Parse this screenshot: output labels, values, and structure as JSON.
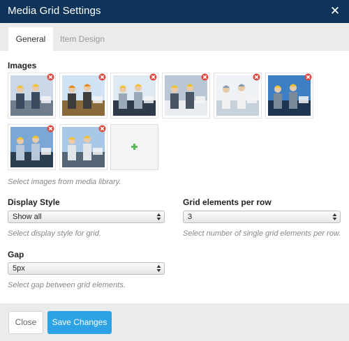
{
  "dialog": {
    "title": "Media Grid Settings",
    "close_icon": "close-icon"
  },
  "tabs": [
    {
      "label": "General",
      "active": true
    },
    {
      "label": "Item Design",
      "active": false
    }
  ],
  "images": {
    "label": "Images",
    "help": "Select images from media library.",
    "thumbnails": [
      {
        "subject": "workers-reviewing-plans",
        "remove_icon": "remove-icon"
      },
      {
        "subject": "construction-tractors",
        "remove_icon": "remove-icon"
      },
      {
        "subject": "engineers-team",
        "remove_icon": "remove-icon"
      },
      {
        "subject": "blueprint-meeting",
        "remove_icon": "remove-icon"
      },
      {
        "subject": "technical-drawing",
        "remove_icon": "remove-icon"
      },
      {
        "subject": "engineer-on-site",
        "remove_icon": "remove-icon"
      },
      {
        "subject": "steel-frame-workers",
        "remove_icon": "remove-icon"
      },
      {
        "subject": "site-inspection",
        "remove_icon": "remove-icon"
      }
    ],
    "add_icon": "add-icon"
  },
  "display_style": {
    "label": "Display Style",
    "value": "Show all",
    "help": "Select display style for grid."
  },
  "grid_per_row": {
    "label": "Grid elements per row",
    "value": "3",
    "help": "Select number of single grid elements per row."
  },
  "gap": {
    "label": "Gap",
    "value": "5px",
    "help": "Select gap between grid elements."
  },
  "footer": {
    "close_label": "Close",
    "save_label": "Save Changes"
  },
  "colors": {
    "header": "#0e3559",
    "accent": "#2da3e5",
    "remove": "#e0483e",
    "add": "#5cb85c"
  }
}
